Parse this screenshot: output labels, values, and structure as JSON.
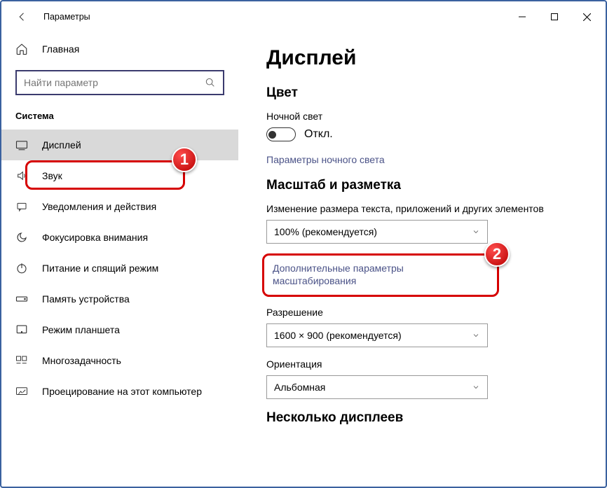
{
  "window": {
    "title": "Параметры"
  },
  "sidebar": {
    "home": "Главная",
    "search_placeholder": "Найти параметр",
    "section": "Система",
    "items": [
      {
        "label": "Дисплей"
      },
      {
        "label": "Звук"
      },
      {
        "label": "Уведомления и действия"
      },
      {
        "label": "Фокусировка внимания"
      },
      {
        "label": "Питание и спящий режим"
      },
      {
        "label": "Память устройства"
      },
      {
        "label": "Режим планшета"
      },
      {
        "label": "Многозадачность"
      },
      {
        "label": "Проецирование на этот компьютер"
      }
    ]
  },
  "main": {
    "heading": "Дисплей",
    "color_section": "Цвет",
    "night_light": "Ночной свет",
    "toggle_state": "Откл.",
    "night_light_settings": "Параметры ночного света",
    "scale_section": "Масштаб и разметка",
    "scale_label": "Изменение размера текста, приложений и других элементов",
    "scale_value": "100% (рекомендуется)",
    "advanced_scaling": "Дополнительные параметры масштабирования",
    "resolution_label": "Разрешение",
    "resolution_value": "1600 × 900 (рекомендуется)",
    "orientation_label": "Ориентация",
    "orientation_value": "Альбомная",
    "multiple_displays": "Несколько дисплеев"
  },
  "annotations": {
    "badge1": "1",
    "badge2": "2"
  }
}
